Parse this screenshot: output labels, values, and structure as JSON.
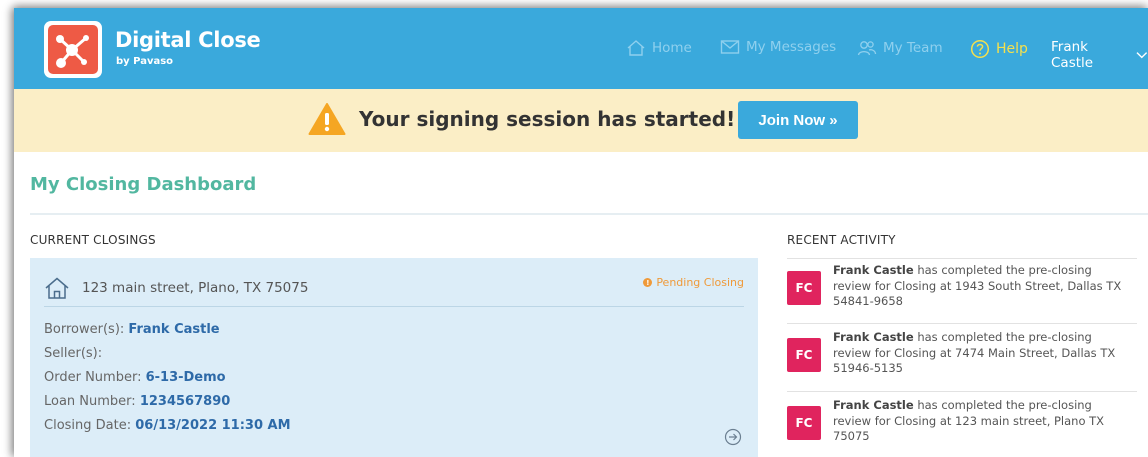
{
  "header": {
    "brand_title": "Digital Close",
    "brand_subtitle": "by Pavaso",
    "nav": {
      "home": "Home",
      "messages": "My Messages",
      "team": "My Team",
      "help": "Help",
      "user": "Frank Castle"
    }
  },
  "banner": {
    "message": "Your signing session has started!",
    "join_label": "Join Now »"
  },
  "dashboard": {
    "title": "My Closing Dashboard",
    "current_heading": "CURRENT CLOSINGS",
    "recent_heading": "RECENT ACTIVITY"
  },
  "closing": {
    "address": "123 main street, Plano, TX 75075",
    "status": "Pending Closing",
    "borrower_label": "Borrower(s):",
    "borrower_value": "Frank Castle",
    "seller_label": "Seller(s):",
    "seller_value": "",
    "order_label": "Order Number:",
    "order_value": "6-13-Demo",
    "loan_label": "Loan Number:",
    "loan_value": "1234567890",
    "date_label": "Closing Date:",
    "date_value": "06/13/2022 11:30 AM"
  },
  "activity": [
    {
      "initials": "FC",
      "name": "Frank Castle",
      "text": " has completed the pre-closing review for Closing at 1943 South Street, Dallas TX 54841-9658"
    },
    {
      "initials": "FC",
      "name": "Frank Castle",
      "text": " has completed the pre-closing review for Closing at 7474 Main Street, Dallas TX 51946-5135"
    },
    {
      "initials": "FC",
      "name": "Frank Castle",
      "text": " has completed the pre-closing review for Closing at 123 main street, Plano TX 75075"
    }
  ],
  "colors": {
    "header": "#3aa9dc",
    "banner": "#fbeec6",
    "accent_green": "#52b7a0",
    "pending": "#ef9a3a",
    "avatar": "#e0245e"
  },
  "icons": [
    "pavaso-logo-icon",
    "home-icon",
    "envelope-icon",
    "team-icon",
    "help-icon",
    "chevron-down-icon",
    "warning-icon",
    "house-icon",
    "info-icon",
    "arrow-right-circle-icon"
  ]
}
